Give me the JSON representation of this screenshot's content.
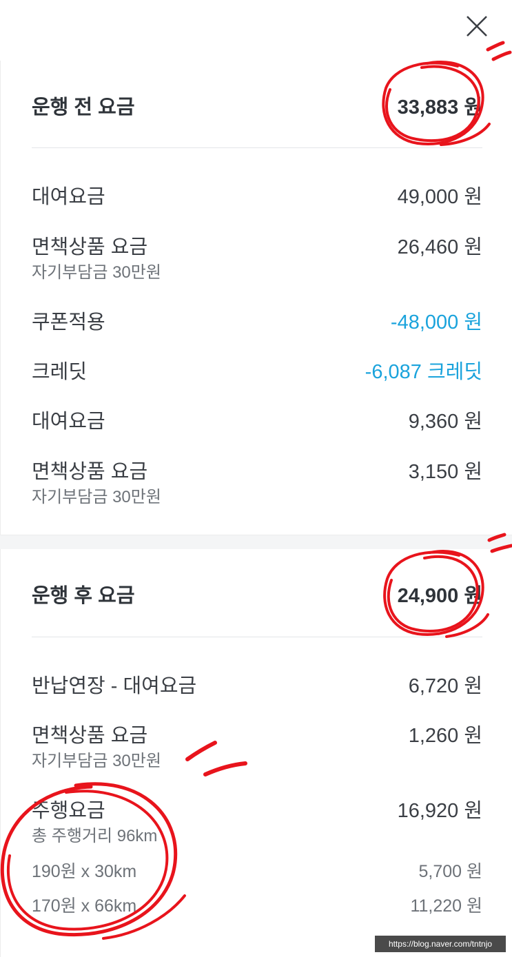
{
  "close_icon": "close-icon",
  "pre_ride": {
    "title": "운행 전 요금",
    "total": "33,883 원",
    "items": [
      {
        "label": "대여요금",
        "value": "49,000 원"
      },
      {
        "label": "면책상품 요금",
        "sub": "자기부담금 30만원",
        "value": "26,460 원"
      },
      {
        "label": "쿠폰적용",
        "value": "-48,000 원",
        "highlight": true
      },
      {
        "label": "크레딧",
        "value": "-6,087 크레딧",
        "highlight": true
      },
      {
        "label": "대여요금",
        "value": "9,360 원"
      },
      {
        "label": "면책상품 요금",
        "sub": "자기부담금 30만원",
        "value": "3,150 원"
      }
    ]
  },
  "post_ride": {
    "title": "운행 후 요금",
    "total": "24,900 원",
    "items": [
      {
        "label": "반납연장 - 대여요금",
        "value": "6,720 원"
      },
      {
        "label": "면책상품 요금",
        "sub": "자기부담금 30만원",
        "value": "1,260 원"
      },
      {
        "label": "주행요금",
        "sub": "총 주행거리 96km",
        "value": "16,920 원"
      }
    ],
    "breakdown": [
      {
        "label": "190원 x 30km",
        "value": "5,700 원"
      },
      {
        "label": "170원 x 66km",
        "value": "11,220 원"
      }
    ]
  },
  "colors": {
    "highlight": "#1aa3dc",
    "annotation": "#e8141c"
  },
  "watermark": "https://blog.naver.com/tntnjo"
}
